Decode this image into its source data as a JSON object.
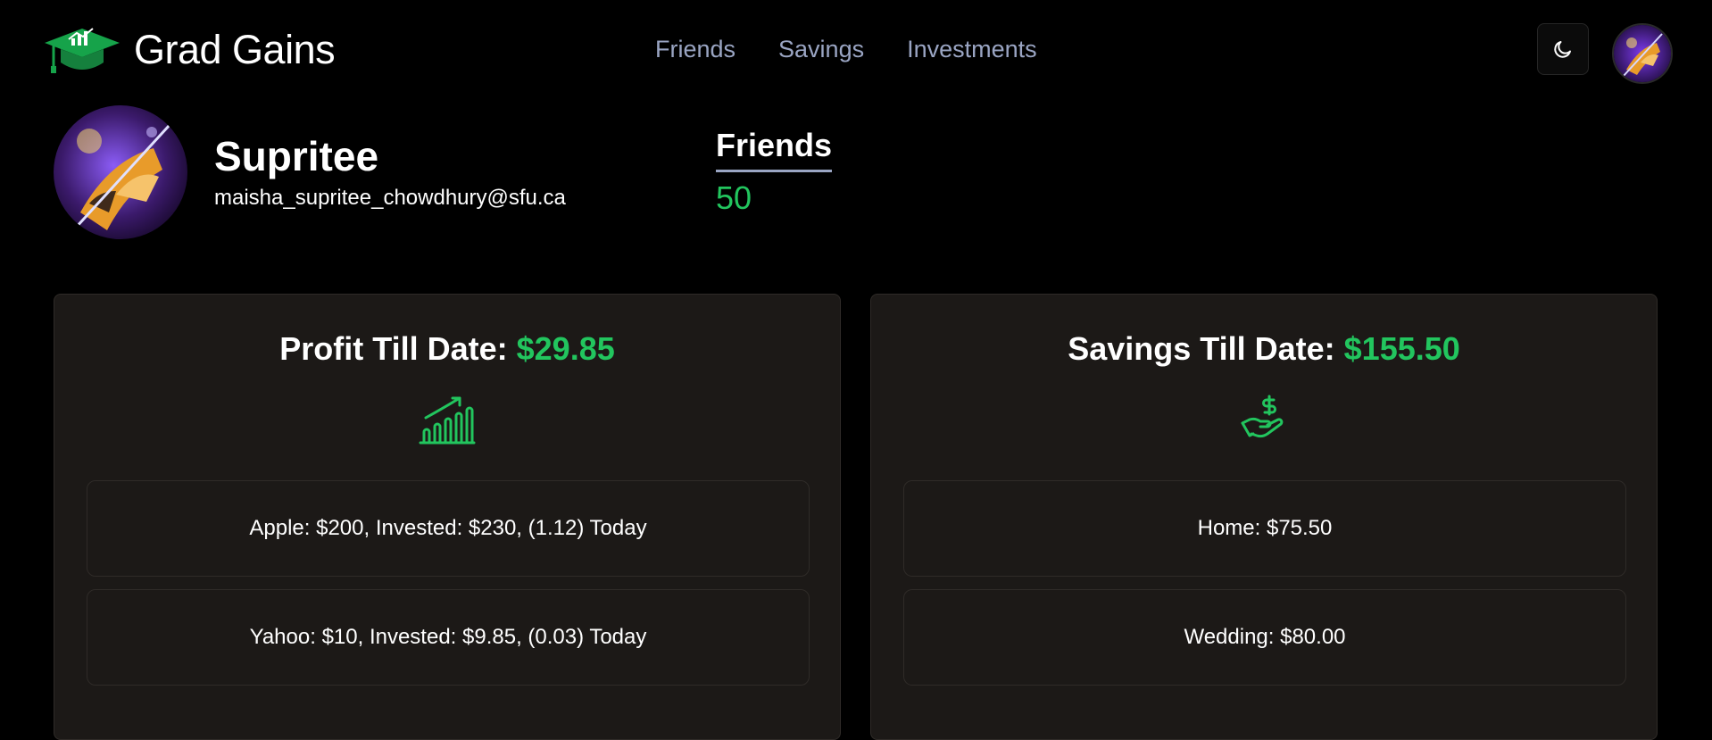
{
  "brand": {
    "name": "Grad Gains",
    "logo_icon": "graduation-cap-chart-icon",
    "accent": "#22c55e"
  },
  "nav": {
    "links": [
      "Friends",
      "Savings",
      "Investments"
    ]
  },
  "header": {
    "theme_icon": "moon-icon"
  },
  "profile": {
    "name": "Supritee",
    "email": "maisha_supritee_chowdhury@sfu.ca"
  },
  "friends": {
    "title": "Friends",
    "count": "50"
  },
  "profit": {
    "label": "Profit Till Date:",
    "value": "$29.85",
    "icon": "growth-chart-icon",
    "items": [
      "Apple: $200, Invested: $230, (1.12) Today",
      "Yahoo: $10, Invested: $9.85, (0.03) Today"
    ]
  },
  "savings": {
    "label": "Savings Till Date:",
    "value": "$155.50",
    "icon": "hand-dollar-icon",
    "items": [
      "Home: $75.50",
      "Wedding: $80.00"
    ]
  },
  "colors": {
    "background": "#000000",
    "card": "#1c1917",
    "accent_green": "#22c55e",
    "nav_link": "#9aa5c3"
  }
}
